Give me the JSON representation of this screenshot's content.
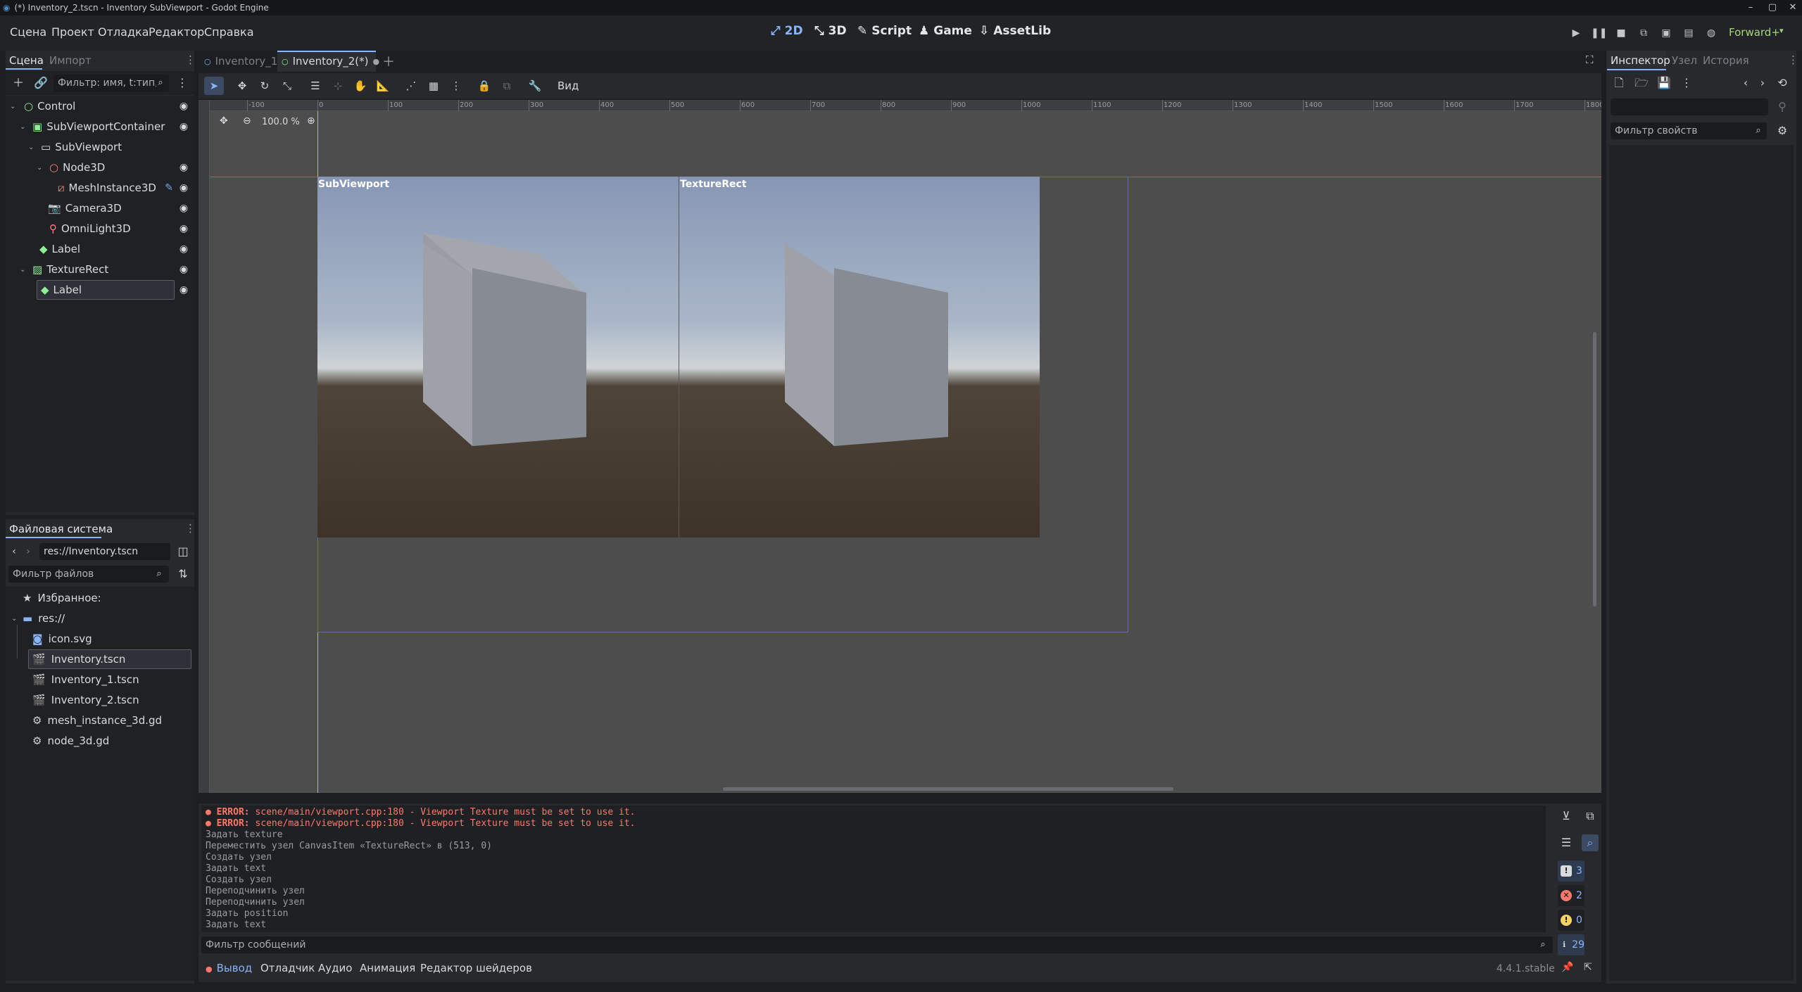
{
  "titlebar": {
    "title": "(*) Inventory_2.tscn - Inventory SubViewport - Godot Engine"
  },
  "menu": [
    "Сцена",
    "Проект",
    "Отладка",
    "Редактор",
    "Справка"
  ],
  "workspaces": [
    "2D",
    "3D",
    "Script",
    "Game",
    "AssetLib"
  ],
  "renderer": "Forward+",
  "scene_panel": {
    "tabs": [
      "Сцена",
      "Импорт"
    ],
    "filter_placeholder": "Фильтр: имя, t:тип, g:группа",
    "nodes": [
      {
        "name": "Control",
        "icon": "control-icon",
        "color": "#8eef97"
      },
      {
        "name": "SubViewportContainer",
        "icon": "subviewportcontainer-icon",
        "color": "#8eef97"
      },
      {
        "name": "SubViewport",
        "icon": "subviewport-icon",
        "color": "#e0e0e0"
      },
      {
        "name": "Node3D",
        "icon": "node3d-icon",
        "color": "#fc7f7f"
      },
      {
        "name": "MeshInstance3D",
        "icon": "meshinstance3d-icon",
        "color": "#fc7f7f"
      },
      {
        "name": "Camera3D",
        "icon": "camera3d-icon",
        "color": "#fc7f7f"
      },
      {
        "name": "OmniLight3D",
        "icon": "omnilight3d-icon",
        "color": "#fc7f7f"
      },
      {
        "name": "Label",
        "icon": "label-icon",
        "color": "#8eef97"
      },
      {
        "name": "TextureRect",
        "icon": "texturerect-icon",
        "color": "#8eef97"
      },
      {
        "name": "Label",
        "icon": "label-icon",
        "color": "#8eef97"
      }
    ]
  },
  "filesystem": {
    "title": "Файловая система",
    "path": "res://Inventory.tscn",
    "filter_placeholder": "Фильтр файлов",
    "items": [
      {
        "name": "Избранное:",
        "icon": "star-icon"
      },
      {
        "name": "res://",
        "icon": "folder-icon"
      },
      {
        "name": "icon.svg",
        "icon": "image-icon"
      },
      {
        "name": "Inventory.tscn",
        "icon": "scene-icon"
      },
      {
        "name": "Inventory_1.tscn",
        "icon": "scene-icon"
      },
      {
        "name": "Inventory_2.tscn",
        "icon": "scene-icon"
      },
      {
        "name": "mesh_instance_3d.gd",
        "icon": "gear-icon"
      },
      {
        "name": "node_3d.gd",
        "icon": "gear-icon"
      }
    ]
  },
  "editor": {
    "tabs": [
      "Inventory_1",
      "Inventory_2(*)"
    ],
    "view_menu": "Вид",
    "zoom": "100.0 %",
    "ruler_labels": [
      "-100",
      "0",
      "100",
      "200",
      "300",
      "400",
      "500",
      "600",
      "700",
      "800",
      "900",
      "1000",
      "1100",
      "1200",
      "1300",
      "1400",
      "1500",
      "1600",
      "1700",
      "1800"
    ],
    "labels": {
      "subviewport": "SubViewport",
      "texturerect": "TextureRect"
    }
  },
  "output": {
    "lines": [
      {
        "type": "error",
        "prefix": "ERROR:",
        "text": "scene/main/viewport.cpp:180 - Viewport Texture must be set to use it."
      },
      {
        "type": "error",
        "prefix": "ERROR:",
        "text": "scene/main/viewport.cpp:180 - Viewport Texture must be set to use it."
      },
      {
        "type": "info",
        "prefix": "",
        "text": "Задать texture"
      },
      {
        "type": "info",
        "prefix": "",
        "text": "Переместить узел CanvasItem «TextureRect» в (513, 0)"
      },
      {
        "type": "info",
        "prefix": "",
        "text": "Создать узел"
      },
      {
        "type": "info",
        "prefix": "",
        "text": "Задать text"
      },
      {
        "type": "info",
        "prefix": "",
        "text": "Создать узел"
      },
      {
        "type": "info",
        "prefix": "",
        "text": "Переподчинить узел"
      },
      {
        "type": "info",
        "prefix": "",
        "text": "Переподчинить узел"
      },
      {
        "type": "info",
        "prefix": "",
        "text": "Задать position"
      },
      {
        "type": "info",
        "prefix": "",
        "text": "Задать text"
      }
    ],
    "filter_placeholder": "Фильтр сообщений",
    "counts": {
      "errors_total": "3",
      "errors": "2",
      "warnings": "0",
      "messages": "29"
    }
  },
  "bottom_tabs": [
    "Вывод",
    "Отладчик",
    "Аудио",
    "Анимация",
    "Редактор шейдеров"
  ],
  "version": "4.4.1.stable",
  "inspector": {
    "tabs": [
      "Инспектор",
      "Узел",
      "История"
    ],
    "filter_placeholder": "Фильтр свойств"
  },
  "colors": {
    "accent": "#8ab4f8",
    "error": "#ff786b",
    "control_node": "#8eef97",
    "node3d": "#fc7f7f"
  }
}
